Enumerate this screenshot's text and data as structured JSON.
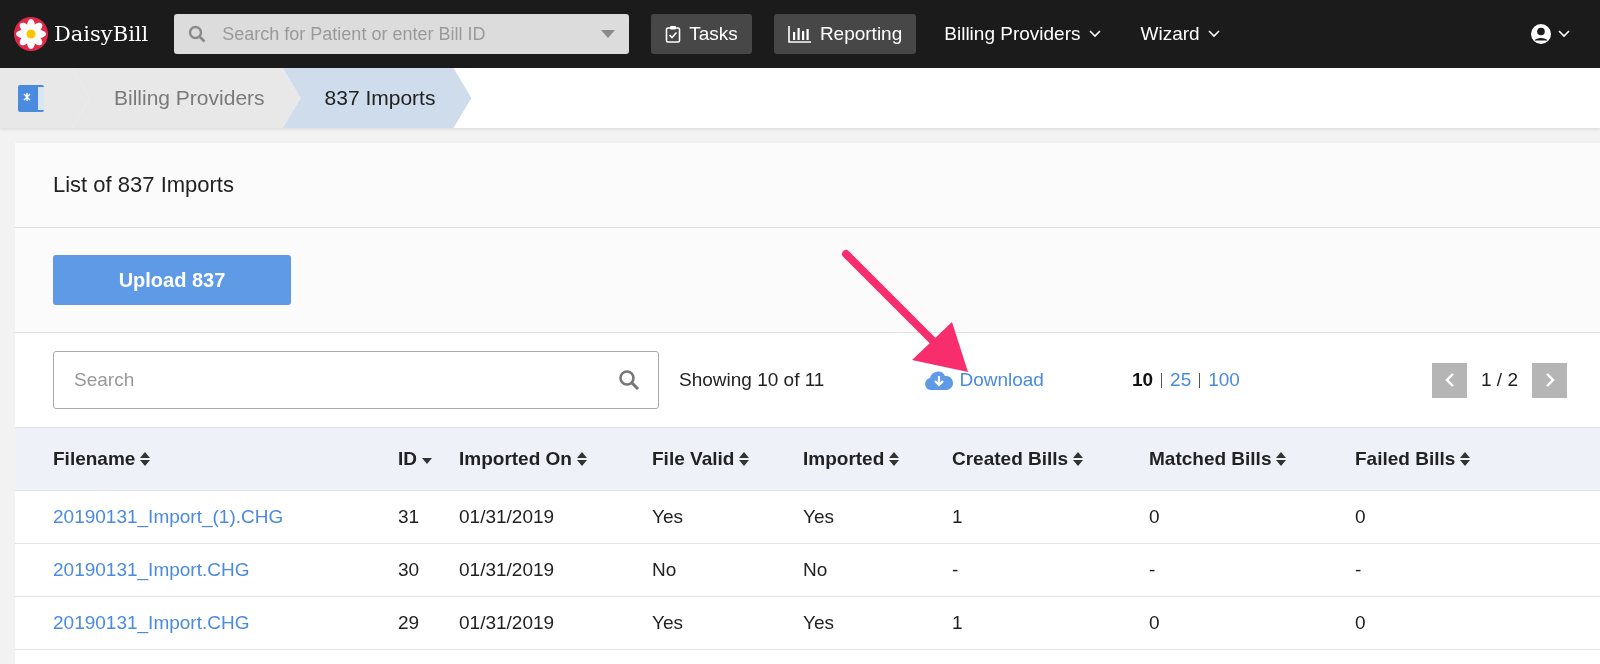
{
  "navbar": {
    "logo": "DaisyBill",
    "search": {
      "placeholder": "Search for Patient or enter Bill ID"
    },
    "items": [
      {
        "kind": "button",
        "label": "Tasks"
      },
      {
        "kind": "button",
        "label": "Reporting"
      },
      {
        "kind": "menu",
        "label": "Billing Providers"
      },
      {
        "kind": "menu",
        "label": "Wizard"
      }
    ]
  },
  "breadcrumb": [
    {
      "label": "Billing Providers",
      "selected": false
    },
    {
      "label": "837 Imports",
      "selected": true
    }
  ],
  "card": {
    "title": "List of 837 Imports",
    "upload_button": "Upload 837",
    "search": {
      "placeholder": "Search"
    },
    "showing": "Showing 10 of 11",
    "download": "Download",
    "page_sizes": [
      {
        "label": "10",
        "selected": true
      },
      {
        "label": "25",
        "selected": false
      },
      {
        "label": "100",
        "selected": false
      }
    ],
    "page": "1 / 2"
  },
  "table": {
    "columns": [
      {
        "label": "Filename",
        "sorted": false
      },
      {
        "label": "ID",
        "sorted": true
      },
      {
        "label": "Imported On",
        "sorted": false
      },
      {
        "label": "File Valid",
        "sorted": false
      },
      {
        "label": "Imported",
        "sorted": false
      },
      {
        "label": "Created Bills",
        "sorted": false
      },
      {
        "label": "Matched Bills",
        "sorted": false
      },
      {
        "label": "Failed Bills",
        "sorted": false
      }
    ],
    "rows": [
      [
        "20190131_Import_(1).CHG",
        "31",
        "01/31/2019",
        "Yes",
        "Yes",
        "1",
        "0",
        "0"
      ],
      [
        "20190131_Import.CHG",
        "30",
        "01/31/2019",
        "No",
        "No",
        "-",
        "-",
        "-"
      ],
      [
        "20190131_Import.CHG",
        "29",
        "01/31/2019",
        "Yes",
        "Yes",
        "1",
        "0",
        "0"
      ]
    ]
  }
}
